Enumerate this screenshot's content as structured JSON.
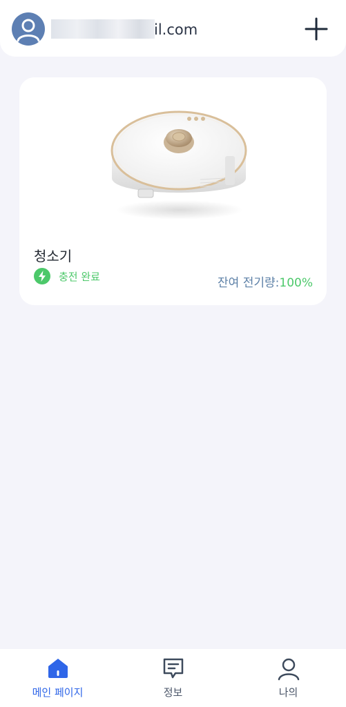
{
  "header": {
    "email_suffix": "il.com",
    "add_icon": "plus-icon",
    "avatar_icon": "user-avatar-icon"
  },
  "device": {
    "name": "청소기",
    "status_text": "충전 완료",
    "status_icon": "lightning-bolt-icon",
    "battery_label": "잔여 전기량:",
    "battery_value": "100%"
  },
  "tabs": [
    {
      "label": "메인 페이지",
      "icon": "home-icon",
      "active": true
    },
    {
      "label": "정보",
      "icon": "message-icon",
      "active": false
    },
    {
      "label": "나의",
      "icon": "profile-icon",
      "active": false
    }
  ],
  "colors": {
    "accent_blue": "#2f66e8",
    "status_green": "#4cc86a",
    "battery_label": "#5b7fa6",
    "background": "#f4f4fa"
  }
}
